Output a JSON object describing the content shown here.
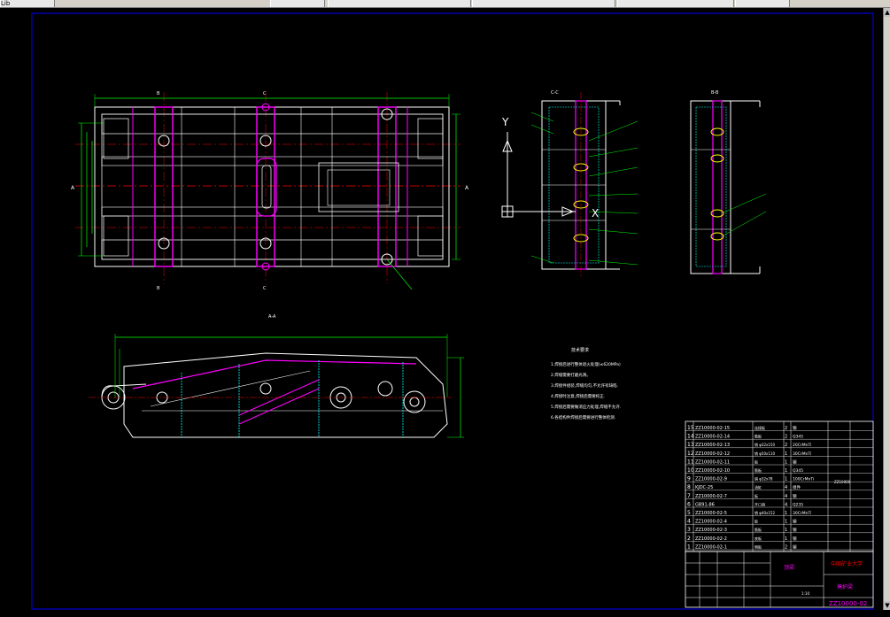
{
  "toolbar": {
    "items": [
      "Lib",
      "",
      "",
      "",
      "",
      ""
    ]
  },
  "drawing": {
    "views": {
      "top_label_1": "",
      "top_label_2": "",
      "section_cc": "C-C",
      "section_bb": "B-B",
      "section_aa": "A-A"
    },
    "axis_y": "Y",
    "axis_x": "X",
    "notes_title": "技术要求",
    "notes": [
      "1.焊接后进行整体退火处理(≤620MPa)",
      "2.焊缝需要打磨光滑。",
      "3.焊接件组装,焊缝均匀,不允许有缺陷.",
      "4.焊接时注意,焊接后需要校正.",
      "5.焊接后需要做消应力处理,焊缝不允许.",
      "6.各结构件焊接后需要进行整体检测."
    ]
  },
  "bom": {
    "rows": [
      {
        "no": "15",
        "code": "ZZ10000-02-15",
        "name": "连接板",
        "qty": "2",
        "material": "钢"
      },
      {
        "no": "14",
        "code": "ZZ10000-02-14",
        "name": "筋板",
        "qty": "2",
        "material": "Q345"
      },
      {
        "no": "13",
        "code": "ZZ10000-02-13",
        "name": "销 φ32x150",
        "qty": "2",
        "material": "20CrMnTi"
      },
      {
        "no": "12",
        "code": "ZZ10000-02-12",
        "name": "销 φ50x110",
        "qty": "1",
        "material": "30CrMnTi"
      },
      {
        "no": "11",
        "code": "ZZ10000-02-11",
        "name": "板",
        "qty": "1",
        "material": "钢"
      },
      {
        "no": "10",
        "code": "ZZ10000-02-10",
        "name": "筋板",
        "qty": "1",
        "material": "Q345"
      },
      {
        "no": "9",
        "code": "ZZ10000-02-9",
        "name": "销 φ32x78",
        "qty": "1",
        "material": "100CrMnTi"
      },
      {
        "no": "8",
        "code": "KJDC-25",
        "name": "油缸",
        "qty": "4",
        "material": "组件"
      },
      {
        "no": "7",
        "code": "ZZ10000-02-7",
        "name": "板",
        "qty": "4",
        "material": "钢"
      },
      {
        "no": "6",
        "code": "GB91-86",
        "name": "开口销",
        "qty": "4",
        "material": "Q235"
      },
      {
        "no": "5",
        "code": "ZZ10000-02-5",
        "name": "销 φ40x152",
        "qty": "1",
        "material": "30CrMnTi"
      },
      {
        "no": "4",
        "code": "ZZ10000-02-4",
        "name": "板",
        "qty": "1",
        "material": "钢"
      },
      {
        "no": "3",
        "code": "ZZ10000-02-3",
        "name": "筋板",
        "qty": "1",
        "material": "钢"
      },
      {
        "no": "2",
        "code": "ZZ10000-02-2",
        "name": "底板",
        "qty": "1",
        "material": "钢"
      },
      {
        "no": "1",
        "code": "ZZ10000-02-1",
        "name": "侧板",
        "qty": "2",
        "material": "钢"
      }
    ],
    "header_note": "ZZ10000"
  },
  "titleblock": {
    "part_name": "顶梁",
    "org": "中国矿业大学",
    "assembly": "掩护梁",
    "drawing_no": "ZZ10000-02",
    "scale": "1:10"
  },
  "colors": {
    "bg": "#000000",
    "outline": "#ffffff",
    "dim": "#00ff00",
    "section": "#ff00ff",
    "center": "#ff0000",
    "frame": "#0000ff"
  }
}
